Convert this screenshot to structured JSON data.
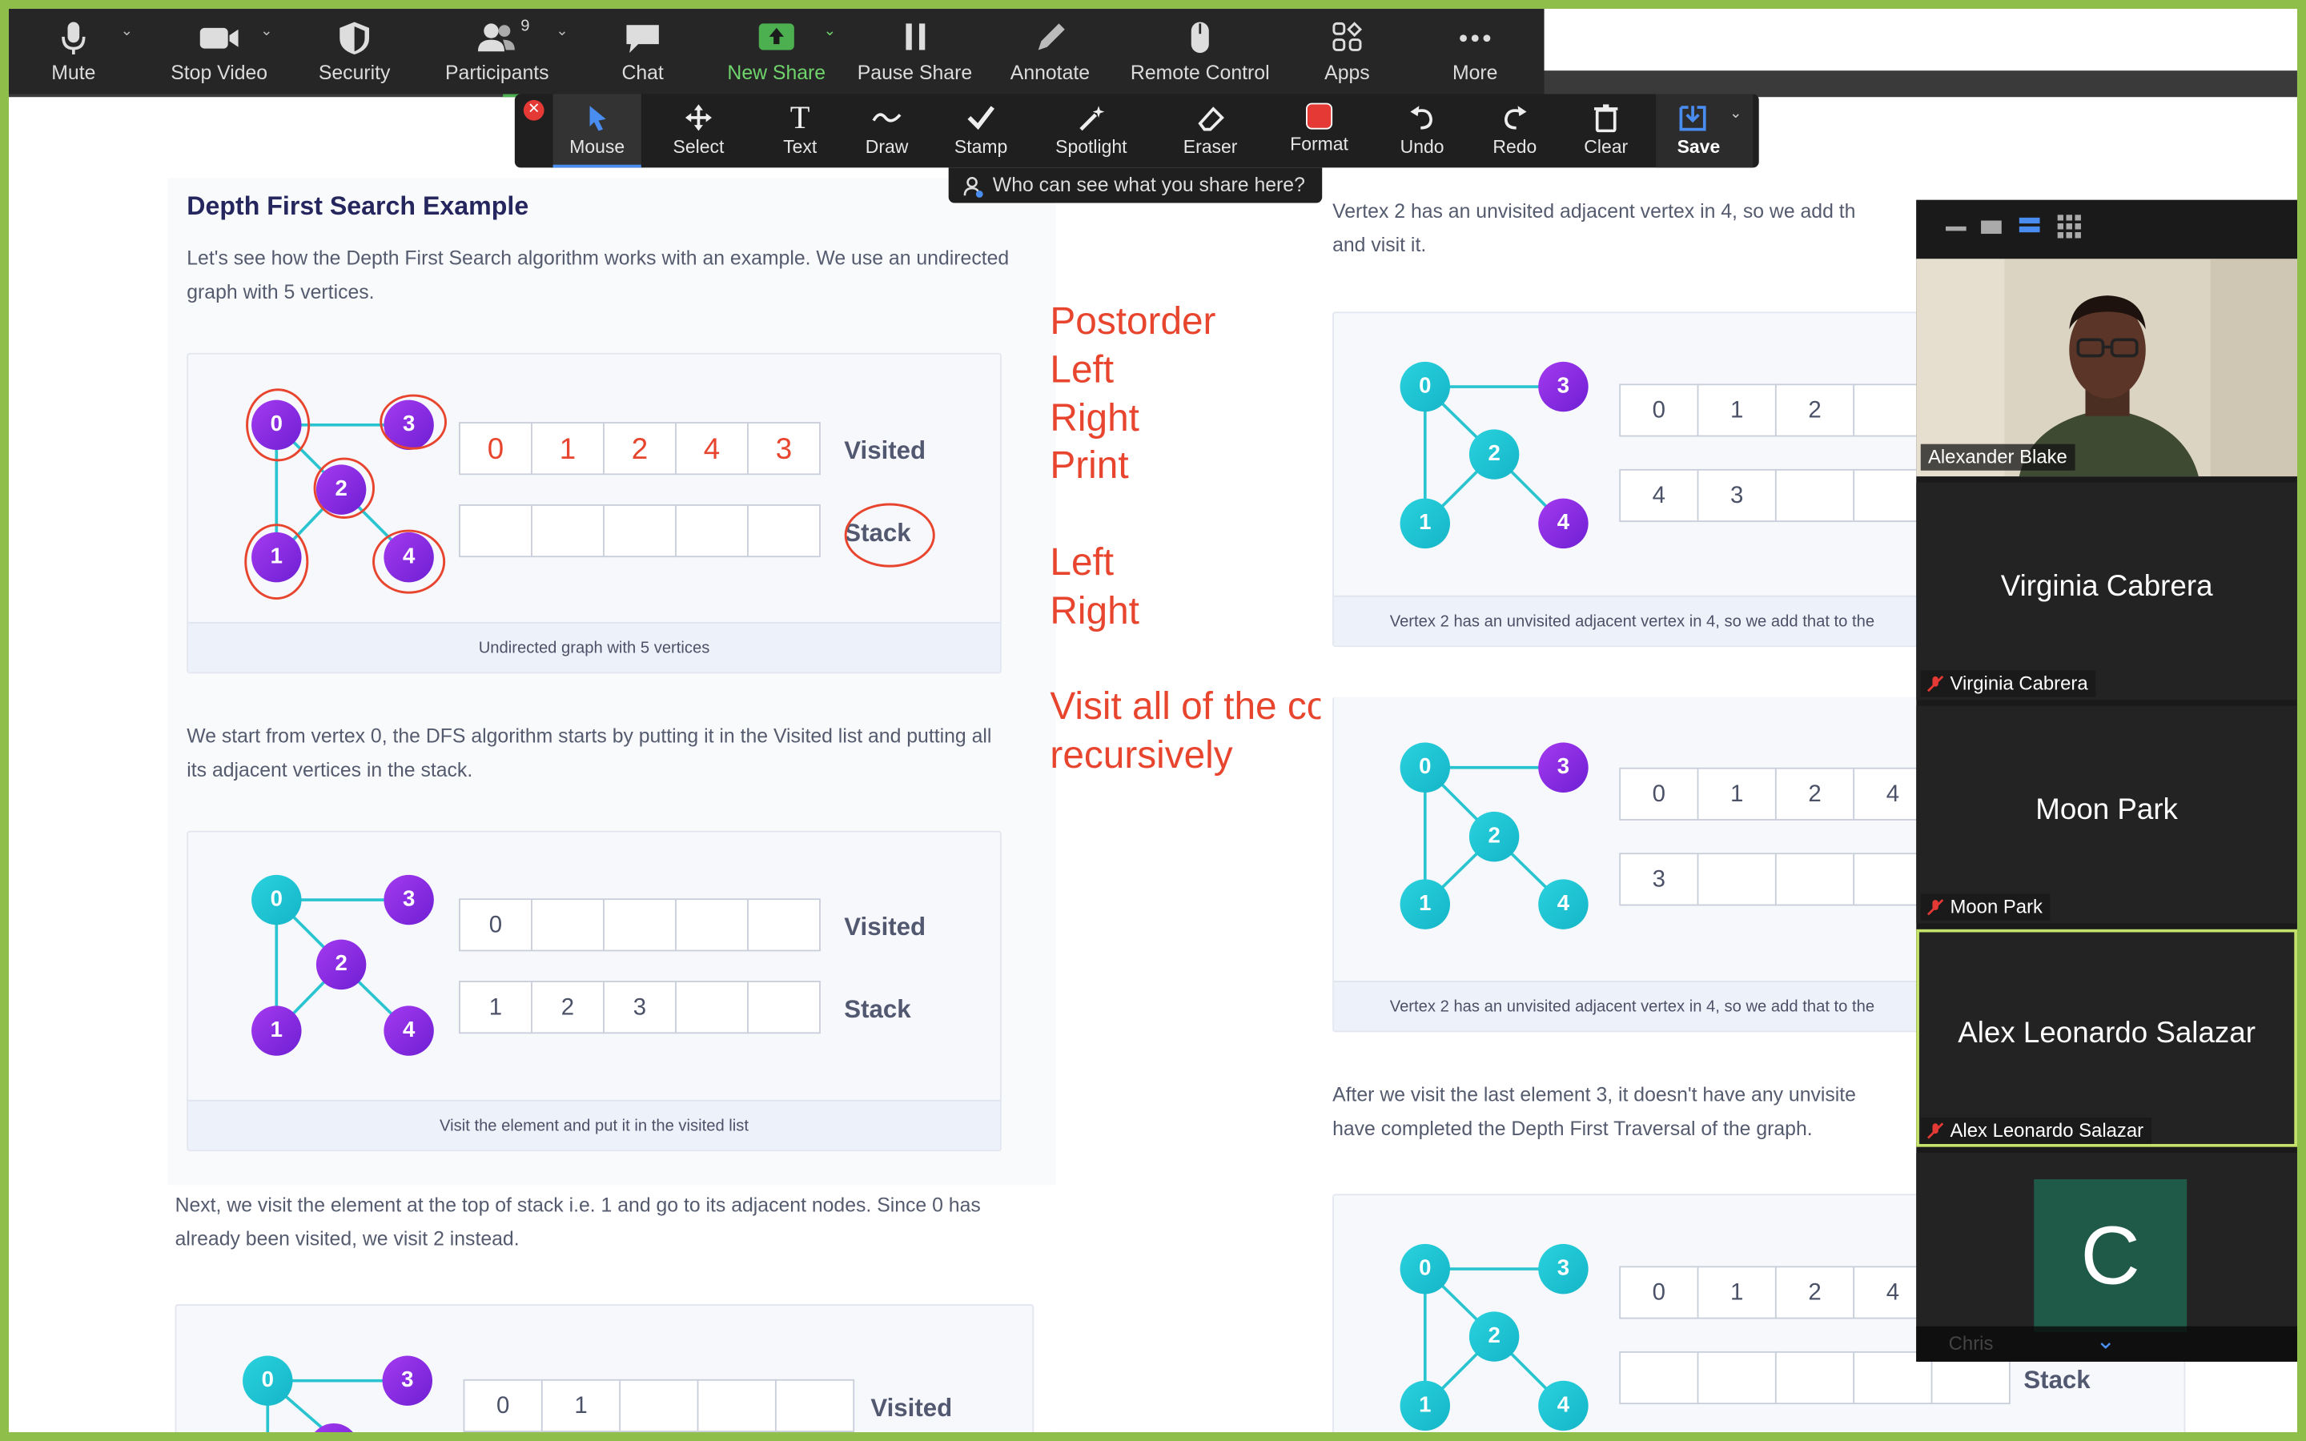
{
  "toolbar": {
    "mute": "Mute",
    "stop_video": "Stop Video",
    "security": "Security",
    "participants": "Participants",
    "participants_count": "9",
    "chat": "Chat",
    "new_share": "New Share",
    "pause_share": "Pause Share",
    "annotate": "Annotate",
    "remote_control": "Remote Control",
    "apps": "Apps",
    "more": "More"
  },
  "annotate_bar": {
    "mouse": "Mouse",
    "select": "Select",
    "text": "Text",
    "draw": "Draw",
    "stamp": "Stamp",
    "spotlight": "Spotlight",
    "eraser": "Eraser",
    "format": "Format",
    "undo": "Undo",
    "redo": "Redo",
    "clear": "Clear",
    "save": "Save",
    "who_can_see": "Who can see what you share here?"
  },
  "colors": {
    "accent_green": "#4caf50",
    "format_red": "#e53935",
    "node_purple": "#7d25e0",
    "node_cyan": "#1ec3d3",
    "annotation_red": "#e8452f"
  },
  "page": {
    "heading": "Depth First Search Example",
    "intro": "Let's see how the Depth First Search algorithm works with an example. We use an undirected graph with 5 vertices.",
    "p_start": "We start from vertex 0, the DFS algorithm starts by putting it in the Visited list and putting all its adjacent vertices in the stack.",
    "p_next": "Next, we visit the element at the top of stack i.e. 1 and go to its adjacent nodes. Since 0 has already been visited, we visit 2 instead.",
    "p_right_top": "Vertex 2 has an unvisited adjacent vertex in 4, so we add th",
    "p_right_top2": "and visit it.",
    "p_after": "After we visit the last element 3, it doesn't have any unvisite",
    "p_after2": "have completed the Depth First Traversal of the graph.",
    "visited_label": "Visited",
    "stack_label": "Stack",
    "cap1": "Undirected graph with 5 vertices",
    "cap2": "Visit the element and put it in the visited list",
    "cap_r1": "Vertex 2 has an unvisited adjacent vertex in 4, so we add that to the",
    "cap_r2": "Vertex 2 has an unvisited adjacent vertex in 4, so we add that to the",
    "card1": {
      "visited": [
        "0",
        "1",
        "2",
        "4",
        "3"
      ],
      "stack": [
        "",
        "",
        "",
        "",
        ""
      ]
    },
    "card2": {
      "visited": [
        "0",
        "",
        "",
        "",
        ""
      ],
      "stack": [
        "1",
        "2",
        "3",
        "",
        ""
      ]
    },
    "card3": {
      "visited": [
        "0",
        "1",
        "",
        "",
        ""
      ]
    },
    "rcard1": {
      "visited": [
        "0",
        "1",
        "2",
        ""
      ],
      "stack": [
        "4",
        "3",
        "",
        ""
      ]
    },
    "rcard2": {
      "visited": [
        "0",
        "1",
        "2",
        "4"
      ],
      "stack": [
        "3",
        "",
        "",
        ""
      ]
    },
    "rcard3": {
      "visited": [
        "0",
        "1",
        "2",
        "4"
      ],
      "stack": [
        "",
        "",
        "",
        "",
        ""
      ]
    },
    "nodes": [
      "0",
      "1",
      "2",
      "3",
      "4"
    ]
  },
  "annotations": {
    "l1": "Postorder",
    "l2": "Left",
    "l3": "Right",
    "l4": "Print",
    "l5": "Left",
    "l6": "Right",
    "l7": "Visit all of the connected nodes",
    "l8": "recursively"
  },
  "gallery": {
    "p1": "Alexander Blake",
    "p2": "Virginia Cabrera",
    "p3": "Moon Park",
    "p4": "Alex Leonardo Salazar",
    "p5_initial": "C",
    "p5": "Chris"
  }
}
